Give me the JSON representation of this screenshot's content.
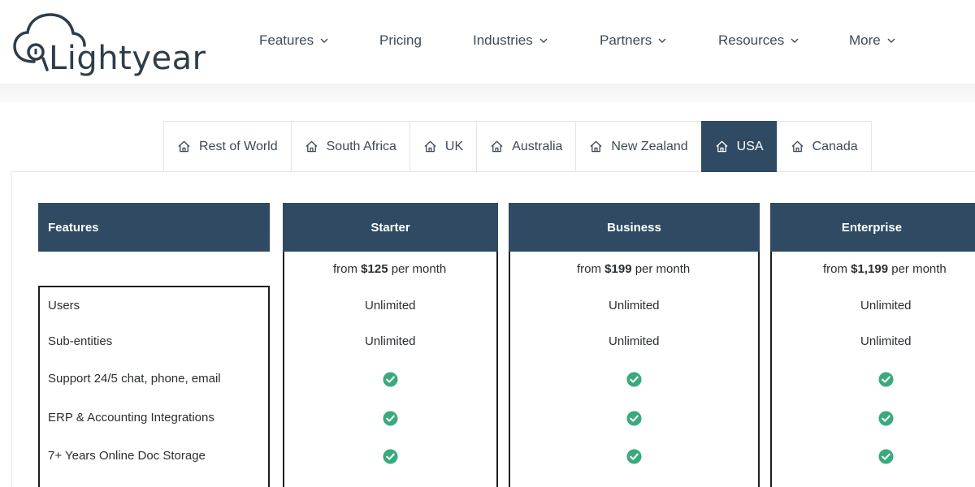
{
  "brand": {
    "name": "Lightyear"
  },
  "nav": [
    {
      "label": "Features",
      "has_dropdown": true
    },
    {
      "label": "Pricing",
      "has_dropdown": false
    },
    {
      "label": "Industries",
      "has_dropdown": true
    },
    {
      "label": "Partners",
      "has_dropdown": true
    },
    {
      "label": "Resources",
      "has_dropdown": true
    },
    {
      "label": "More",
      "has_dropdown": true
    }
  ],
  "regions": {
    "tabs": [
      "Rest of World",
      "South Africa",
      "UK",
      "Australia",
      "New Zealand",
      "USA",
      "Canada"
    ],
    "active": "USA",
    "icon": "home-icon"
  },
  "pricing": {
    "features_header": "Features",
    "plans": [
      {
        "name": "Starter",
        "price_prefix": "from ",
        "price": "$125",
        "price_suffix": " per month"
      },
      {
        "name": "Business",
        "price_prefix": "from ",
        "price": "$199",
        "price_suffix": " per month"
      },
      {
        "name": "Enterprise",
        "price_prefix": "from ",
        "price": "$1,199",
        "price_suffix": " per month"
      }
    ],
    "rows": [
      {
        "feature": "Users",
        "values": [
          "Unlimited",
          "Unlimited",
          "Unlimited"
        ]
      },
      {
        "feature": "Sub-entities",
        "values": [
          "Unlimited",
          "Unlimited",
          "Unlimited"
        ]
      },
      {
        "feature": "Support 24/5 chat, phone, email",
        "values": [
          "check",
          "check",
          "check"
        ]
      },
      {
        "feature": "ERP & Accounting Integrations",
        "values": [
          "check",
          "check",
          "check"
        ]
      },
      {
        "feature": "7+ Years Online Doc Storage",
        "values": [
          "check",
          "check",
          "check"
        ]
      }
    ]
  },
  "colors": {
    "accent": "#2f4a62",
    "check": "#3aaa7e",
    "text": "#2f3d4a"
  }
}
